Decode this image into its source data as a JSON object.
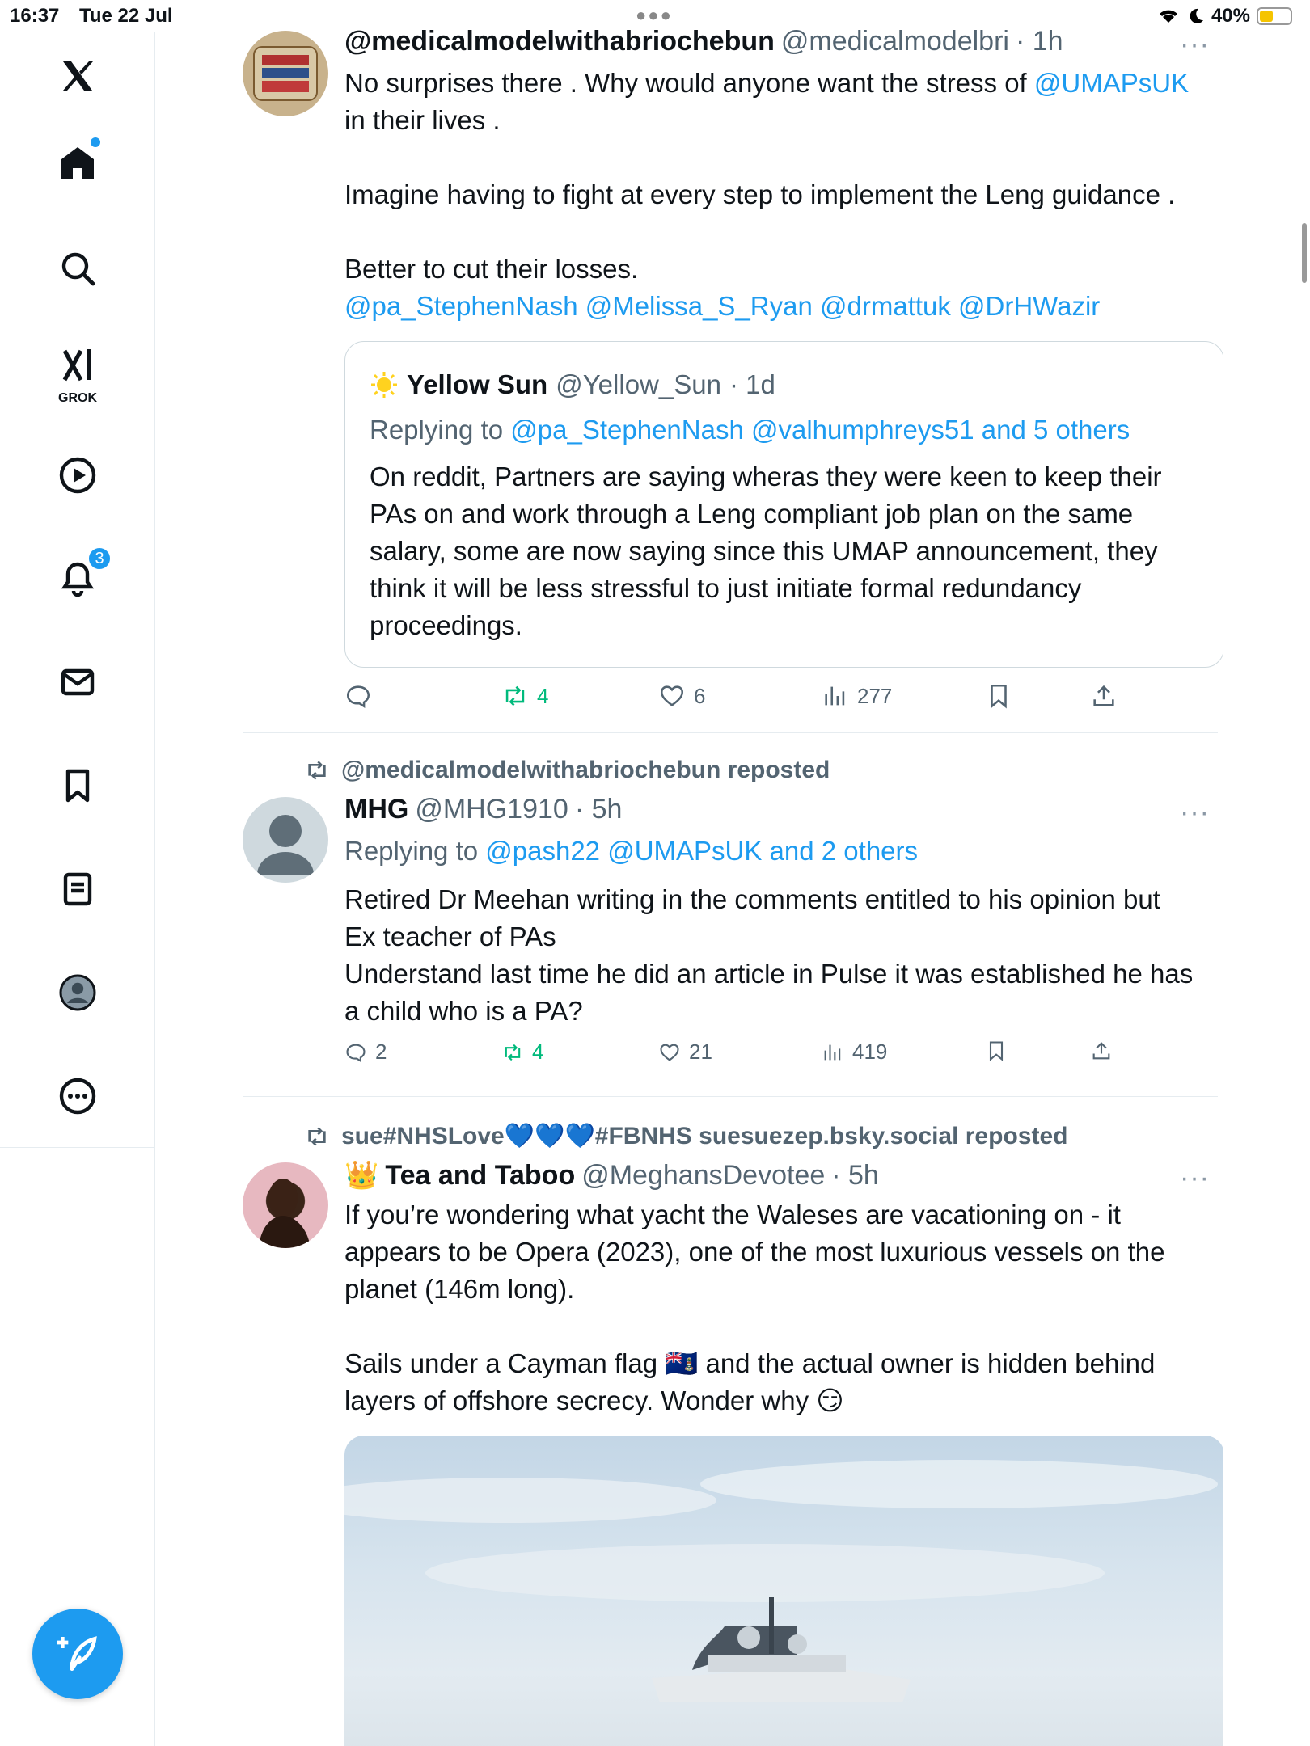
{
  "status_bar": {
    "time": "16:37",
    "date": "Tue 22 Jul",
    "battery": "40%",
    "battery_level": 0.4
  },
  "sidebar": {
    "grok_label": "GROK",
    "notifications_badge": "3"
  },
  "tweets": [
    {
      "name": "@medicalmodelwithabriochebun",
      "handle": "@medicalmodelbri",
      "time": "· 1h",
      "body": {
        "line1_pre": "No surprises there . Why would anyone want the stress of ",
        "line1_link": "@UMAPsUK",
        "line1_post": " in their lives .",
        "para2": "Imagine having to fight at every step to implement the Leng guidance .",
        "para3": "Better to cut their losses.",
        "mentions": "@pa_StephenNash @Melissa_S_Ryan @drmattuk @DrHWazir"
      },
      "quote": {
        "name": "Yellow Sun",
        "handle": "@Yellow_Sun",
        "time": "· 1d",
        "replying_prefix": "Replying to ",
        "replying_to": "@pa_StephenNash @valhumphreys51 and 5 others",
        "body": "On reddit, Partners are saying wheras they were keen to keep their PAs on and work through a Leng compliant job plan on the same salary, some are now saying since this UMAP announcement, they think it will be less stressful to just initiate formal redundancy proceedings."
      },
      "actions": {
        "replies": "",
        "reposts": "4",
        "likes": "6",
        "views": "277"
      }
    },
    {
      "repost_by": "@medicalmodelwithabriochebun reposted",
      "name": "MHG",
      "handle": "@MHG1910",
      "time": "· 5h",
      "replying_prefix": "Replying to ",
      "replying_to": "@pash22 @UMAPsUK and 2 others",
      "body": "Retired Dr Meehan writing in the comments entitled to his opinion but\nEx teacher of PAs\nUnderstand last time he did an article in Pulse it was established he has a child who is a PA?",
      "actions": {
        "replies": "2",
        "reposts": "4",
        "likes": "21",
        "views": "419"
      }
    },
    {
      "repost_by": "sue#NHSLove💙💙💙#FBNHS suesuezep.bsky.social reposted",
      "crown": "👑",
      "name": "Tea and Taboo",
      "handle": "@MeghansDevotee",
      "time": "· 5h",
      "body_p1": "If you’re wondering what yacht the Waleses are vacationing on - it appears to be Opera (2023), one of the most luxurious vessels on the planet (146m long).",
      "body_p2": "Sails under a Cayman flag 🇰🇾 and the actual owner is hidden behind layers of offshore secrecy. Wonder why 😏"
    }
  ],
  "colors": {
    "accent": "#1d9bf0",
    "repost_green": "#00ba7c",
    "secondary_text": "#536471"
  }
}
